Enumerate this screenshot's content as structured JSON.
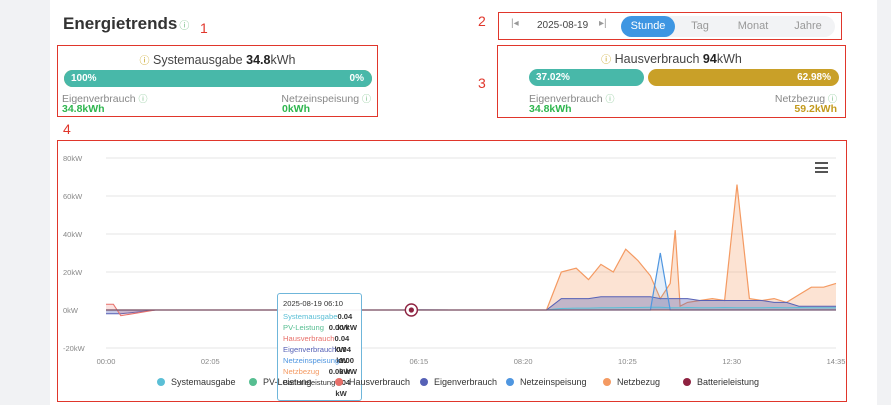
{
  "header": {
    "title": "Energietrends"
  },
  "annotations": [
    "1",
    "2",
    "3",
    "4"
  ],
  "summary": {
    "title_prefix": "Systemausgabe",
    "title_value": "34.8",
    "title_unit": "kWh",
    "bar_left_pct": "100%",
    "bar_right_pct": "0%",
    "bar_fraction": 1.0,
    "left_label": "Eigenverbrauch",
    "left_value": "34.8kWh",
    "right_label": "Netzeinspeisung",
    "right_value": "0kWh"
  },
  "controls": {
    "prev_icon": "skip-back-icon",
    "next_icon": "skip-forward-icon",
    "date": "2025-08-19",
    "tabs": [
      {
        "label": "Stunde",
        "active": true
      },
      {
        "label": "Tag",
        "active": false
      },
      {
        "label": "Monat",
        "active": false
      },
      {
        "label": "Jahre",
        "active": false
      }
    ]
  },
  "house": {
    "title_prefix": "Hausverbrauch",
    "title_value": "94",
    "title_unit": "kWh",
    "bar_left_pct": "37.02%",
    "bar_right_pct": "62.98%",
    "bar_fraction": 0.3702,
    "left_label": "Eigenverbrauch",
    "left_value": "34.8kWh",
    "right_label": "Netzbezug",
    "right_value": "59.2kWh"
  },
  "colors": {
    "accent_teal": "#48b8a9",
    "accent_gold": "#c9a028",
    "tab_active": "#3e96e2",
    "value_green": "#2eb64e",
    "value_gold": "#c39a1c",
    "annotation_red": "#e0362b"
  },
  "chart_data": {
    "type": "area",
    "y_tick_labels": [
      "80kW",
      "60kW",
      "40kW",
      "20kW",
      "0kW",
      "-20kW"
    ],
    "x_tick_labels": [
      "00:00",
      "02:05",
      "04:10",
      "06:15",
      "08:20",
      "10:25",
      "12:30",
      "14:35"
    ],
    "ylim": [
      -20,
      80
    ],
    "grid": true,
    "legend_position": "bottom",
    "x_hours": [
      0,
      0.15,
      0.3,
      1.0,
      2.0,
      3.0,
      4.0,
      5.0,
      6.0,
      6.17,
      7.0,
      8.0,
      8.3,
      8.9,
      9.05,
      9.2,
      9.5,
      9.75,
      10.0,
      10.25,
      10.5,
      10.75,
      11.0,
      11.2,
      11.4,
      11.5,
      11.6,
      11.75,
      12.0,
      12.25,
      12.5,
      12.75,
      13.0,
      13.25,
      13.5,
      13.75,
      14.0,
      14.25,
      14.5,
      14.75
    ],
    "series": [
      {
        "name": "Systemausgabe",
        "color": "#5bbfd6",
        "values": [
          0,
          0,
          0,
          0,
          0,
          0,
          0,
          0,
          0,
          0.04,
          0,
          0,
          0,
          0,
          0.5,
          0.8,
          1,
          1,
          1.2,
          1.2,
          1.3,
          1.3,
          1.4,
          1.4,
          1.2,
          1.2,
          1.2,
          1.3,
          1.2,
          1.2,
          1.3,
          1.2,
          1.2,
          1.2,
          1.3,
          1.2,
          1.3,
          1.2,
          1.2,
          1.2
        ]
      },
      {
        "name": "PV-Leistung",
        "color": "#56be91",
        "values": [
          0,
          0,
          0,
          0,
          0,
          0,
          0,
          0,
          0,
          0,
          0,
          0,
          0,
          0,
          0,
          0,
          0,
          0,
          0,
          0,
          0,
          0,
          0,
          0,
          0,
          0,
          0,
          0,
          0,
          0,
          0,
          0,
          0,
          0,
          0,
          0,
          0,
          0,
          0,
          0
        ]
      },
      {
        "name": "Hausverbrauch",
        "color": "#e8706a",
        "values": [
          3,
          3,
          -3,
          0,
          0,
          0,
          0,
          0,
          0,
          0.04,
          0,
          0,
          0,
          0,
          0,
          0,
          0,
          0,
          0,
          0,
          0,
          0,
          0,
          0,
          0,
          0,
          0,
          0,
          0,
          0,
          0,
          0,
          0,
          0,
          0,
          0,
          0,
          0,
          0,
          0
        ]
      },
      {
        "name": "Eigenverbrauch",
        "color": "#5661b6",
        "values": [
          -2,
          -2,
          -2,
          0,
          0,
          0,
          0,
          0,
          0,
          0.04,
          0,
          0,
          0,
          0,
          3,
          6,
          6,
          6,
          7,
          7,
          7,
          7,
          7,
          6,
          6,
          6,
          6,
          6,
          5,
          5,
          5,
          5,
          5,
          5,
          4,
          4,
          2,
          2,
          2,
          2
        ]
      },
      {
        "name": "Netzeinspeisung",
        "color": "#4f96e0",
        "values": [
          0,
          0,
          0,
          0,
          0,
          0,
          0,
          0,
          0,
          0,
          0,
          0,
          0,
          0,
          0,
          0,
          0,
          0,
          0,
          0,
          0,
          0,
          0,
          30,
          0,
          0,
          0,
          0,
          0,
          0,
          0,
          0,
          0,
          0,
          0,
          0,
          0,
          0,
          0,
          0
        ]
      },
      {
        "name": "Netzbezug",
        "color": "#f49a62",
        "values": [
          0,
          0,
          0,
          0,
          0,
          0,
          0,
          0,
          0,
          0,
          0,
          0,
          0,
          0,
          10,
          20,
          22,
          16,
          24,
          20,
          32,
          26,
          18,
          6,
          14,
          42,
          2,
          4,
          5,
          6,
          5,
          66,
          6,
          5,
          6,
          4,
          8,
          12,
          12,
          14
        ]
      },
      {
        "name": "Batterieleistung",
        "color": "#8e2240",
        "values": [
          0,
          0,
          0,
          0,
          0,
          0,
          0,
          0,
          0,
          0,
          0,
          0,
          0,
          0,
          0,
          0,
          0,
          0,
          0,
          0,
          0,
          0,
          0,
          0,
          0,
          0,
          0,
          0,
          0,
          0,
          0,
          0,
          0,
          0,
          0,
          0,
          0,
          0,
          0,
          0
        ]
      }
    ],
    "tooltip": {
      "title": "2025-08-19 06:10",
      "rows": [
        {
          "label": "Systemausgabe",
          "value": "0.04 kW",
          "color": "#5bbfd6"
        },
        {
          "label": "PV-Leistung",
          "value": "0.00 kW",
          "color": "#56be91"
        },
        {
          "label": "Hausverbrauch",
          "value": "0.04 kW",
          "color": "#e8706a"
        },
        {
          "label": "Eigenverbrauch",
          "value": "0.04 kW",
          "color": "#5661b6"
        },
        {
          "label": "Netzeinspeisung",
          "value": "0.00 kW",
          "color": "#4f96e0"
        },
        {
          "label": "Netzbezug",
          "value": "0.00 kW",
          "color": "#f49a62"
        },
        {
          "label": "Batterieleistung",
          "value": "0.04 kW",
          "color": "#333333"
        }
      ]
    },
    "hover_hour": 6.17,
    "legend": [
      {
        "label": "Systemausgabe",
        "color": "#5bbfd6"
      },
      {
        "label": "PV-Leistung",
        "color": "#56be91"
      },
      {
        "label": "Hausverbrauch",
        "color": "#e8706a"
      },
      {
        "label": "Eigenverbrauch",
        "color": "#5661b6"
      },
      {
        "label": "Netzeinspeisung",
        "color": "#4f96e0"
      },
      {
        "label": "Netzbezug",
        "color": "#f49a62"
      },
      {
        "label": "Batterieleistung",
        "color": "#8e2240"
      }
    ]
  }
}
